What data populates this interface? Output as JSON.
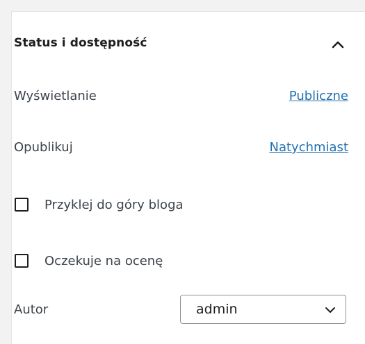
{
  "panel": {
    "title": "Status i dostępność",
    "collapse_icon": "chevron-up-icon"
  },
  "visibility": {
    "label": "Wyświetlanie",
    "value": "Publiczne"
  },
  "publish": {
    "label": "Opublikuj",
    "value": "Natychmiast"
  },
  "sticky": {
    "label": "Przyklej do góry bloga",
    "checked": false
  },
  "pending": {
    "label": "Oczekuje na ocenę",
    "checked": false
  },
  "author": {
    "label": "Autor",
    "selected": "admin",
    "dropdown_icon": "chevron-down-icon"
  },
  "colors": {
    "link": "#2271b1",
    "text": "#1e1e1e",
    "muted_text": "#3c434a"
  }
}
